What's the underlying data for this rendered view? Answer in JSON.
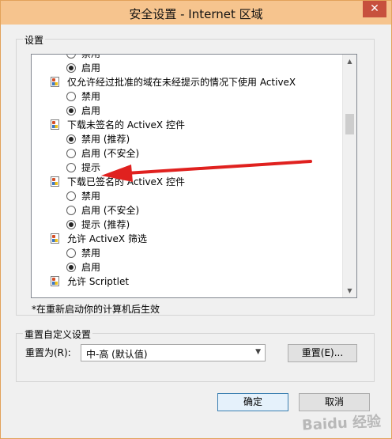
{
  "window": {
    "title": "安全设置 - Internet 区域",
    "close_label": "✕"
  },
  "settings": {
    "group_label": "设置",
    "items": [
      {
        "kind": "option",
        "label": "禁用",
        "checked": false
      },
      {
        "kind": "option",
        "label": "启用",
        "checked": true
      },
      {
        "kind": "heading",
        "label": "仅允许经过批准的域在未经提示的情况下使用 ActiveX"
      },
      {
        "kind": "option",
        "label": "禁用",
        "checked": false
      },
      {
        "kind": "option",
        "label": "启用",
        "checked": true
      },
      {
        "kind": "heading",
        "label": "下载未签名的 ActiveX 控件"
      },
      {
        "kind": "option",
        "label": "禁用 (推荐)",
        "checked": true
      },
      {
        "kind": "option",
        "label": "启用 (不安全)",
        "checked": false
      },
      {
        "kind": "option",
        "label": "提示",
        "checked": false
      },
      {
        "kind": "heading",
        "label": "下载已签名的 ActiveX 控件"
      },
      {
        "kind": "option",
        "label": "禁用",
        "checked": false
      },
      {
        "kind": "option",
        "label": "启用 (不安全)",
        "checked": false
      },
      {
        "kind": "option",
        "label": "提示 (推荐)",
        "checked": true
      },
      {
        "kind": "heading",
        "label": "允许 ActiveX 筛选"
      },
      {
        "kind": "option",
        "label": "禁用",
        "checked": false
      },
      {
        "kind": "option",
        "label": "启用",
        "checked": true
      },
      {
        "kind": "heading",
        "label": "允许 Scriptlet"
      }
    ],
    "note": "*在重新启动你的计算机后生效"
  },
  "reset": {
    "group_label": "重置自定义设置",
    "reset_to_label": "重置为(R):",
    "level_value": "中-高 (默认值)",
    "reset_button": "重置(E)..."
  },
  "buttons": {
    "ok": "确定",
    "cancel": "取消"
  },
  "watermark": "Baidu 经验",
  "icons": {
    "close": "close-icon",
    "setting_item": "setting-doc-icon",
    "scroll_up": "scroll-up-icon",
    "scroll_down": "scroll-down-icon",
    "dropdown": "chevron-down-icon",
    "annotation": "red-arrow-icon"
  },
  "colors": {
    "titlebar": "#f6c48e",
    "close": "#c7503d",
    "annotation_arrow": "#e0211f"
  }
}
